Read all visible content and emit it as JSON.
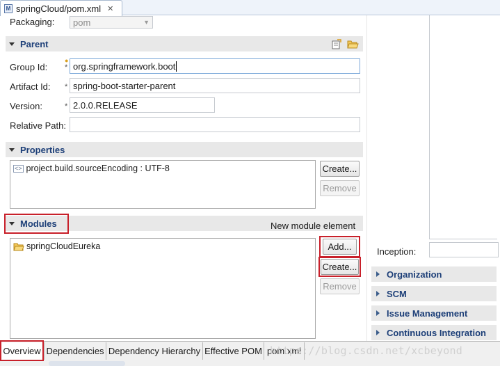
{
  "editor_tab": {
    "title": "springCloud/pom.xml",
    "icon": "M",
    "close_glyph": "✕"
  },
  "packaging": {
    "label": "Packaging:",
    "value": "pom"
  },
  "parent": {
    "title": "Parent",
    "group_id": {
      "label": "Group Id:",
      "value": "org.springframework.boot"
    },
    "artifact_id": {
      "label": "Artifact Id:",
      "value": "spring-boot-starter-parent"
    },
    "version": {
      "label": "Version:",
      "value": "2.0.0.RELEASE"
    },
    "relative_path": {
      "label": "Relative Path:",
      "value": ""
    },
    "required_mark": "*"
  },
  "properties": {
    "title": "Properties",
    "items": [
      "project.build.sourceEncoding : UTF-8"
    ],
    "create_label": "Create...",
    "remove_label": "Remove"
  },
  "modules": {
    "title": "Modules",
    "hint": "New module element",
    "items": [
      "springCloudEureka"
    ],
    "add_label": "Add...",
    "create_label": "Create...",
    "remove_label": "Remove"
  },
  "right_panel": {
    "inception_label": "Inception:",
    "sections": [
      "Organization",
      "SCM",
      "Issue Management",
      "Continuous Integration"
    ]
  },
  "bottom_tabs": [
    "Overview",
    "Dependencies",
    "Dependency Hierarchy",
    "Effective POM",
    "pom.xml"
  ],
  "watermark": "https://blog.csdn.net/xcbeyond",
  "colors": {
    "highlight_red": "#c8202a",
    "section_title_blue": "#1d3f78",
    "section_bg": "#e8e8e8"
  }
}
